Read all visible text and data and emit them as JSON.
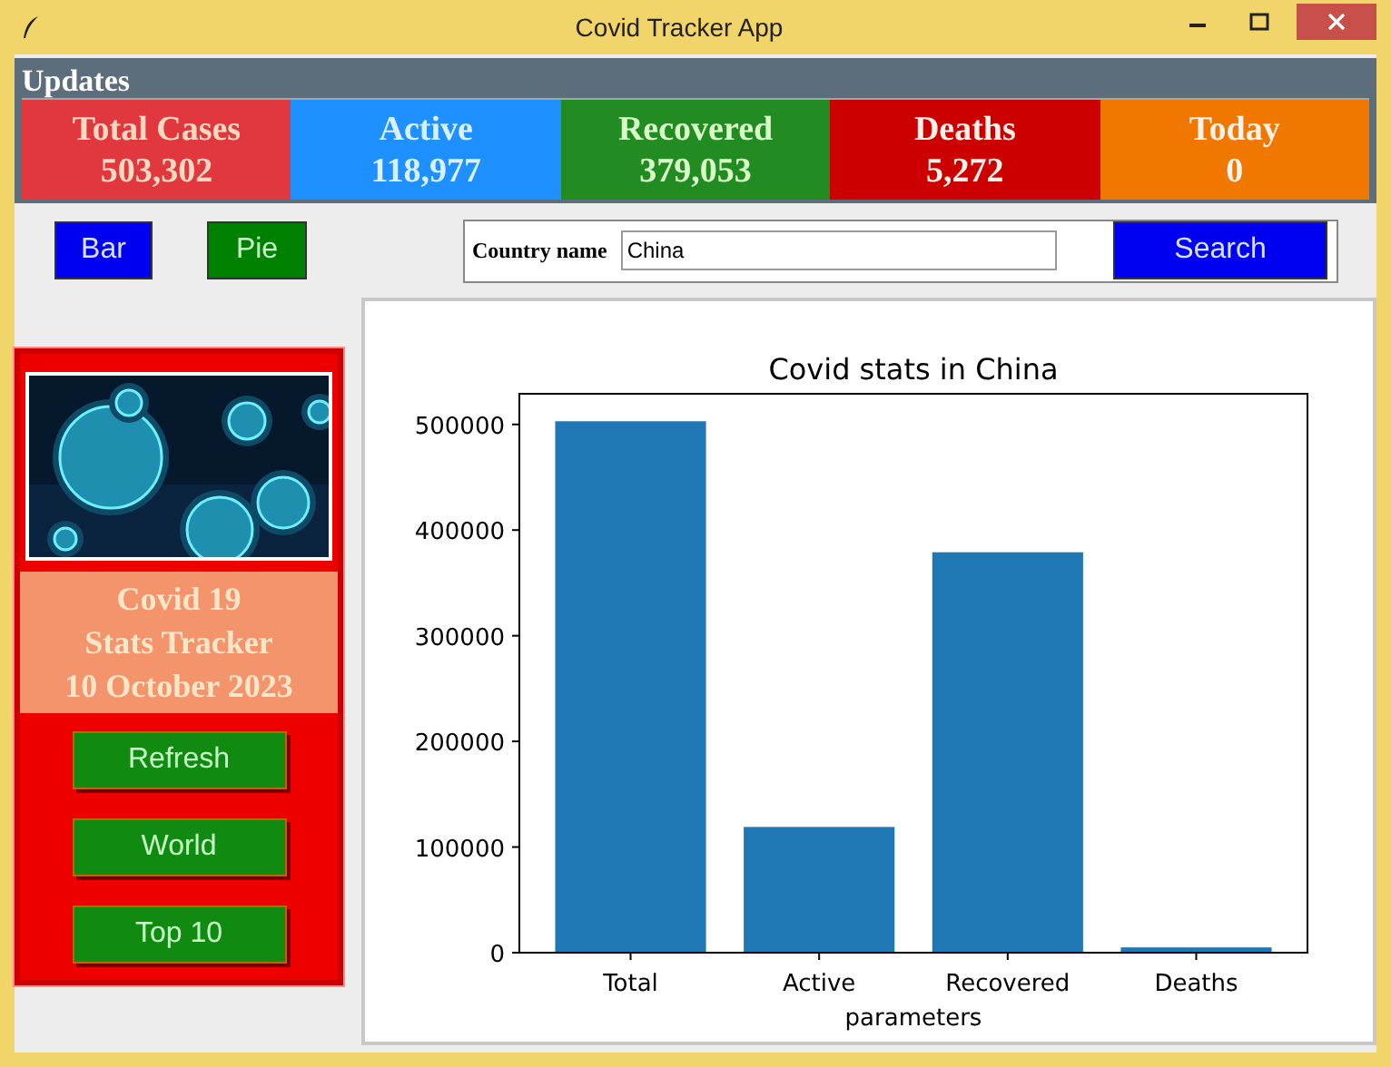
{
  "window": {
    "title": "Covid Tracker App"
  },
  "updates": {
    "label": "Updates",
    "cards": [
      {
        "label": "Total Cases",
        "value": "503,302",
        "color": "#e0383e"
      },
      {
        "label": "Active",
        "value": "118,977",
        "color": "#1e90ff"
      },
      {
        "label": "Recovered",
        "value": "379,053",
        "color": "#228b22"
      },
      {
        "label": "Deaths",
        "value": "5,272",
        "color": "#cc0000"
      },
      {
        "label": "Today",
        "value": "0",
        "color": "#f07800"
      }
    ]
  },
  "chart_buttons": [
    {
      "label": "Bar",
      "color": "#0000f0"
    },
    {
      "label": "Pie",
      "color": "#008000"
    }
  ],
  "search": {
    "label": "Country name",
    "value": "China",
    "button": "Search"
  },
  "sidebar": {
    "title_lines": [
      "Covid 19",
      "Stats Tracker",
      "10 October 2023"
    ],
    "buttons": [
      "Refresh",
      "World",
      "Top 10"
    ]
  },
  "chart": {
    "chart_data": {
      "type": "bar",
      "title": "Covid stats in China",
      "xlabel": "parameters",
      "categories": [
        "Total",
        "Active",
        "Recovered",
        "Deaths"
      ],
      "series": [
        {
          "color": "#1f77b4",
          "values": [
            503000,
            119000,
            379000,
            5000
          ]
        }
      ],
      "ylim": [
        0,
        529000
      ],
      "yticks": [
        0,
        100000,
        200000,
        300000,
        400000,
        500000
      ]
    }
  }
}
